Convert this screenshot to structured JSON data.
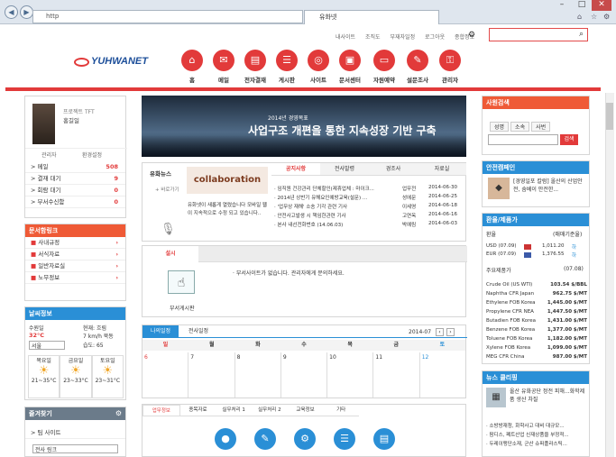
{
  "browser": {
    "address": "http",
    "tab": "유화넷",
    "back": "◀",
    "forward": "▶",
    "star": "☆",
    "home": "⌂",
    "gear": "⚙"
  },
  "toplinks": [
    "내사이트",
    "조직도",
    "부재자일정",
    "로그아웃",
    "종합정보"
  ],
  "logo": "YUHWANET",
  "menu": [
    {
      "label": "홈",
      "icon": "⌂"
    },
    {
      "label": "메일",
      "icon": "✉"
    },
    {
      "label": "전자결재",
      "icon": "▤"
    },
    {
      "label": "게시판",
      "icon": "☰"
    },
    {
      "label": "사이트",
      "icon": "◎"
    },
    {
      "label": "문서센터",
      "icon": "▣"
    },
    {
      "label": "자원예약",
      "icon": "▭"
    },
    {
      "label": "설문조사",
      "icon": "✎"
    },
    {
      "label": "관리자",
      "icon": "⚿"
    }
  ],
  "profile": {
    "dept": "프로젝트 TFT",
    "name": "홍길일",
    "admin": "관리자",
    "settings": "환경설정"
  },
  "stats": [
    {
      "label": "메일",
      "value": "508"
    },
    {
      "label": "결재 대기",
      "value": "9"
    },
    {
      "label": "회람 대기",
      "value": "0"
    },
    {
      "label": "부서수신함",
      "value": "0"
    }
  ],
  "docbox": {
    "title": "문서함링크",
    "items": [
      "사내규정",
      "서식자료",
      "일반자료실",
      "노무정보"
    ]
  },
  "weather": {
    "title": "날씨정보",
    "place": "수원일",
    "now": "현재: 흐림",
    "temp": "32°C",
    "wind": "7 km/h 북동",
    "city": "서울",
    "humidity": "습도: 65",
    "days": [
      {
        "d": "목요일",
        "t": "21~35°C"
      },
      {
        "d": "금요일",
        "t": "23~33°C"
      },
      {
        "d": "토요일",
        "t": "23~31°C"
      }
    ]
  },
  "favs": {
    "title": "즐겨찾기",
    "items": [
      "팀 사이트",
      "전사 링크"
    ]
  },
  "banner": {
    "line1": "2014년 경영목표",
    "line2": "사업구조 개편을 통한 지속성장 기반 구축"
  },
  "news": {
    "left_title": "유화뉴스",
    "more": "+ 바로가기",
    "collab": "collaboration",
    "text": "유화넷이 새롭게 열렸습니다 모바일 웹이 지속적으로 수정 되고 있습니다..",
    "tabs": [
      "공지사항",
      "전사발령",
      "경조사",
      "자료실"
    ],
    "rows": [
      {
        "t": "· 임직원 건강관리 단체할인(제휴업체 : 마이크...",
        "w": "업무전",
        "d": "2014-06-30"
      },
      {
        "t": "· 2014년 상반기 유해요인예방교육(설문) ...",
        "w": "성에문",
        "d": "2014-06-25"
      },
      {
        "t": "· '업무상 재해' 소송 기각 관련 기사",
        "w": "이세영",
        "d": "2014-06-18"
      },
      {
        "t": "· 안전사고발생 시 책임한관련 기사",
        "w": "고연옥",
        "d": "2014-06-16"
      },
      {
        "t": "· 본사 내선전화번호 (14.06.03)",
        "w": "박예림",
        "d": "2014-06-03"
      }
    ]
  },
  "survey": {
    "tab": "설시",
    "board": "부서게시판",
    "note": "· 부서사이트가 없습니다. 관리자에게 문의하세요."
  },
  "calendar": {
    "tabs": [
      "나의일정",
      "전사일정"
    ],
    "month": "2014-07",
    "days": [
      "일",
      "월",
      "화",
      "수",
      "목",
      "금",
      "토"
    ],
    "dates": [
      "6",
      "7",
      "8",
      "9",
      "10",
      "11",
      "12"
    ]
  },
  "bottomtabs": [
    "업무정보",
    "종목자료",
    "실무처리 1",
    "실무처리 2",
    "교육정보",
    "기타"
  ],
  "emp": {
    "title": "사원검색",
    "opts": [
      "성명",
      "소속",
      "사번"
    ],
    "btn": "검색"
  },
  "safety": {
    "title": "안전캠페인",
    "text": "[경영일포 칼럼] 올산의 산업안전, 숨베이 안전한..."
  },
  "fx": {
    "title": "환율/제품가",
    "l1": "환율",
    "l1r": "(매매기준율)",
    "rates": [
      {
        "n": "USD (07.09)",
        "v": "1,011.20",
        "c": "하"
      },
      {
        "n": "EUR (07.09)",
        "v": "1,376.55",
        "c": "하"
      }
    ],
    "l2": "주요제품가",
    "l2r": "(07.08)",
    "products": [
      {
        "n": "Crude Oil (US WTI)",
        "v": "103.54 $/BBL"
      },
      {
        "n": "Naphtha CFR Japan",
        "v": "962.75 $/MT"
      },
      {
        "n": "Ethylene FOB Korea",
        "v": "1,445.00 $/MT"
      },
      {
        "n": "Propylene CFR NEA",
        "v": "1,447.50 $/MT"
      },
      {
        "n": "Butadien FOB Korea",
        "v": "1,431.00 $/MT"
      },
      {
        "n": "Benzene FOB Korea",
        "v": "1,377.00 $/MT"
      },
      {
        "n": "Toluene FOB Korea",
        "v": "1,182.00 $/MT"
      },
      {
        "n": "Xylene FOB Korea",
        "v": "1,099.00 $/MT"
      },
      {
        "n": "MEG CFR China",
        "v": "987.00 $/MT"
      }
    ]
  },
  "clip": {
    "title": "뉴스 클리핑",
    "headline": "올산 유화공단 정전 피해...화학제품 생산 차질",
    "items": [
      "· 소방방재청, 화학사고 대비 대규모...",
      "· 팜디스, 폐트산업 신재상품을 부정적...",
      "· 두레이맹단소재, 군산 슈퍼플라스틱..."
    ]
  }
}
